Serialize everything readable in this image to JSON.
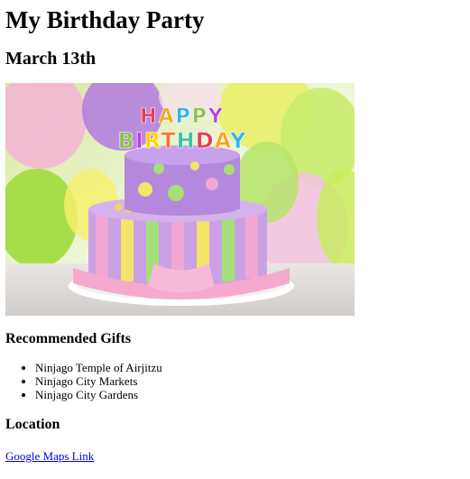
{
  "page": {
    "title": "My Birthday Party",
    "date": "March 13th",
    "image": {
      "text_line1": "HAPPY",
      "text_line2": "BIRTHDAY",
      "letter_colors": [
        "#e63b5a",
        "#f5a623",
        "#2fb4e9",
        "#8bc34a",
        "#c13ce0",
        "#ffd200",
        "#ff6f3c",
        "#3cc1a6"
      ]
    },
    "gifts": {
      "heading": "Recommended Gifts",
      "items": [
        "Ninjago Temple of Airjitzu",
        "Ninjago City Markets",
        "Ninjago City Gardens"
      ]
    },
    "location": {
      "heading": "Location",
      "link_text": "Google Maps Link"
    }
  }
}
